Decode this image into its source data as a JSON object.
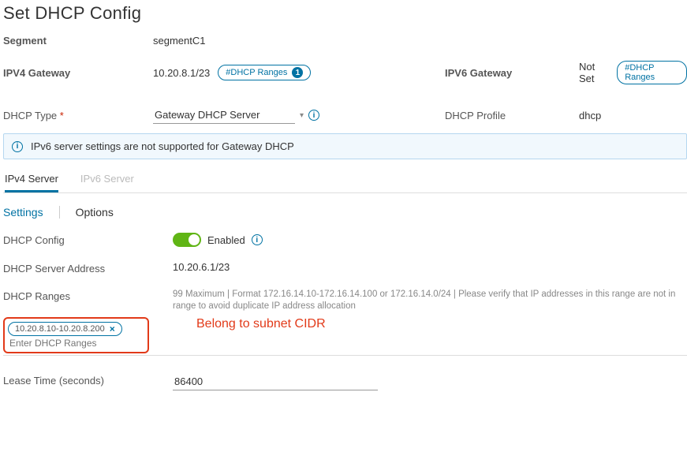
{
  "title": "Set DHCP Config",
  "segment": {
    "label": "Segment",
    "value": "segmentC1"
  },
  "gateways": {
    "ipv4": {
      "label": "IPV4 Gateway",
      "value": "10.20.8.1/23",
      "ranges_label": "#DHCP Ranges",
      "ranges_count": "1"
    },
    "ipv6": {
      "label": "IPV6 Gateway",
      "value": "Not Set",
      "ranges_label": "#DHCP Ranges"
    }
  },
  "dhcp_type": {
    "label": "DHCP Type",
    "value": "Gateway DHCP Server"
  },
  "dhcp_profile": {
    "label": "DHCP Profile",
    "value": "dhcp"
  },
  "alert": "IPv6 server settings are not supported for Gateway DHCP",
  "server_tabs": {
    "ipv4": "IPv4 Server",
    "ipv6": "IPv6 Server"
  },
  "sub_tabs": {
    "settings": "Settings",
    "options": "Options"
  },
  "config": {
    "dhcp_config": {
      "label": "DHCP Config",
      "status": "Enabled"
    },
    "server_addr": {
      "label": "DHCP Server Address",
      "value": "10.20.6.1/23"
    },
    "ranges": {
      "label": "DHCP Ranges",
      "hint": "99 Maximum | Format 172.16.14.10-172.16.14.100 or 172.16.14.0/24 | Please verify that IP addresses in this range are not in range to avoid duplicate IP address allocation",
      "chip": "10.20.8.10-10.20.8.200",
      "placeholder": "Enter DHCP Ranges",
      "annotation": "Belong to subnet CIDR"
    },
    "lease": {
      "label": "Lease Time (seconds)",
      "value": "86400"
    }
  }
}
